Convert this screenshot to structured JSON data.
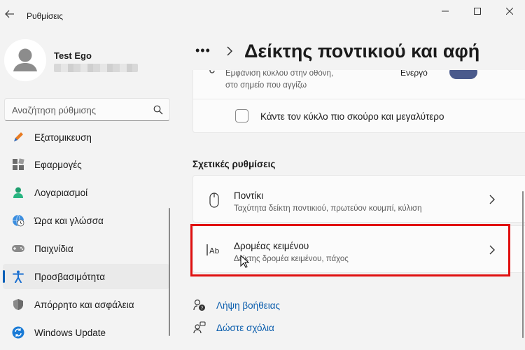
{
  "window": {
    "app_title": "Ρυθμίσεις"
  },
  "user": {
    "name": "Test Ego"
  },
  "search": {
    "placeholder": "Αναζήτηση ρύθμισης"
  },
  "sidebar": {
    "items": [
      {
        "label": "Εξατομικευση",
        "icon": "personalization-brush-icon",
        "selected": false
      },
      {
        "label": "Εφαρμογές",
        "icon": "apps-icon",
        "selected": false
      },
      {
        "label": "Λογαριασμοί",
        "icon": "accounts-person-icon",
        "selected": false
      },
      {
        "label": "Ώρα και γλώσσα",
        "icon": "time-language-globe-icon",
        "selected": false
      },
      {
        "label": "Παιχνίδια",
        "icon": "gamepad-icon",
        "selected": false
      },
      {
        "label": "Προσβασιμότητα",
        "icon": "accessibility-person-icon",
        "selected": true
      },
      {
        "label": "Απόρρητο και ασφάλεια",
        "icon": "shield-icon",
        "selected": false
      },
      {
        "label": "Windows Update",
        "icon": "windows-update-sync-icon",
        "selected": false
      }
    ]
  },
  "header": {
    "breadcrumb_more": "•••",
    "title": "Δείκτης ποντικιού και αφή"
  },
  "touch_indicator": {
    "description_line1": "Εμφάνιση κύκλου στην οθόνη,",
    "description_line2": "στο σημείο που αγγίζω",
    "status": "Ενεργό",
    "toggle_on": true,
    "darker_circle_label": "Κάντε τον κύκλο πιο σκούρο και μεγαλύτερο",
    "darker_circle_checked": false
  },
  "related": {
    "heading": "Σχετικές ρυθμίσεις",
    "items": [
      {
        "title": "Ποντίκι",
        "subtitle": "Ταχύτητα δείκτη ποντικιού, πρωτεύον κουμπί, κύλιση",
        "icon": "mouse-icon"
      },
      {
        "title": "Δρομέας κειμένου",
        "subtitle": "Δείκτης δρομέα κειμένου, πάχος",
        "icon": "text-cursor-ab-icon"
      }
    ]
  },
  "help": {
    "get_help": "Λήψη βοήθειας",
    "feedback": "Δώστε σχόλια"
  },
  "colors": {
    "accent": "#005fb8",
    "highlight": "#e01010",
    "toggle_on": "#4a5a8c",
    "background": "#f3f3f3",
    "card": "#fbfbfb"
  }
}
